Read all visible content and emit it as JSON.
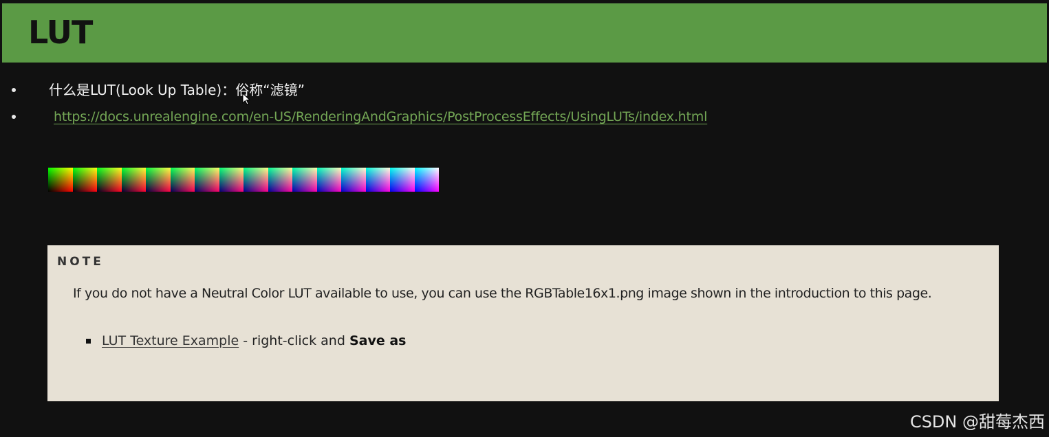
{
  "slide": {
    "title": "LUT",
    "bullets": [
      {
        "text": "什么是LUT(Look Up Table)：俗称“滤镜”"
      },
      {
        "link": "https://docs.unrealengine.com/en-US/RenderingAndGraphics/PostProcessEffects/UsingLUTs/index.html"
      }
    ],
    "lut_strip": {
      "tile_count": 16,
      "colors": [
        "#000000",
        "#ff0000",
        "#00ff00",
        "#ffff00",
        "#0000ff",
        "#ff00ff",
        "#00ffff",
        "#ffffff"
      ]
    },
    "note": {
      "heading": "NOTE",
      "body": "If you do not have a Neutral Color LUT available to use, you can use the RGBTable16x1.png image shown in the introduction to this page.",
      "list_items": [
        {
          "link_text": "LUT Texture Example",
          "middle_text": " - right-click and ",
          "bold_text": "Save as"
        }
      ]
    },
    "watermark": "CSDN @甜莓杰西"
  },
  "colors": {
    "background": "#111111",
    "title_bar": "#5b9a45",
    "link": "#73a655",
    "note_background": "#e7e1d5"
  },
  "icons": {
    "cursor": "mouse-cursor-icon"
  }
}
